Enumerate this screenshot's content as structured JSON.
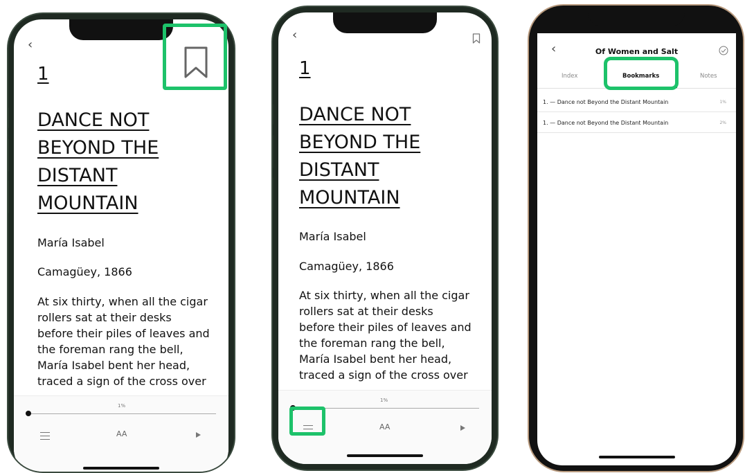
{
  "reader": {
    "chapter_number": "1",
    "chapter_title": "DANCE NOT BEYOND THE DISTANT MOUNTAIN",
    "author_line": "María Isabel",
    "place_line": "Camagüey, 1866",
    "body_text": "At six thirty, when all the cigar rollers sat at their desks before their piles of leaves and the foreman rang the bell, María Isabel bent her head, traced a sign of the cross over",
    "progress": "1%",
    "progress_fraction": 0.01,
    "font_button": "AA"
  },
  "bookmarks_screen": {
    "book_title": "Of Women and Salt",
    "tabs": [
      {
        "label": "Index"
      },
      {
        "label": "Bookmarks"
      },
      {
        "label": "Notes"
      }
    ],
    "items": [
      {
        "label": "1. — Dance not Beyond the Distant Mountain",
        "percent": "1%"
      },
      {
        "label": "1. — Dance not Beyond the Distant Mountain",
        "percent": "2%"
      }
    ]
  },
  "colors": {
    "highlight": "#1dc26a",
    "phone_frame_green": "#1f2a22",
    "phone_frame_gold": "#b89a7e"
  },
  "icons": [
    "back-chevron-icon",
    "bookmark-icon",
    "table-of-contents-icon",
    "font-size-icon",
    "play-icon",
    "checkmark-circle-icon"
  ]
}
